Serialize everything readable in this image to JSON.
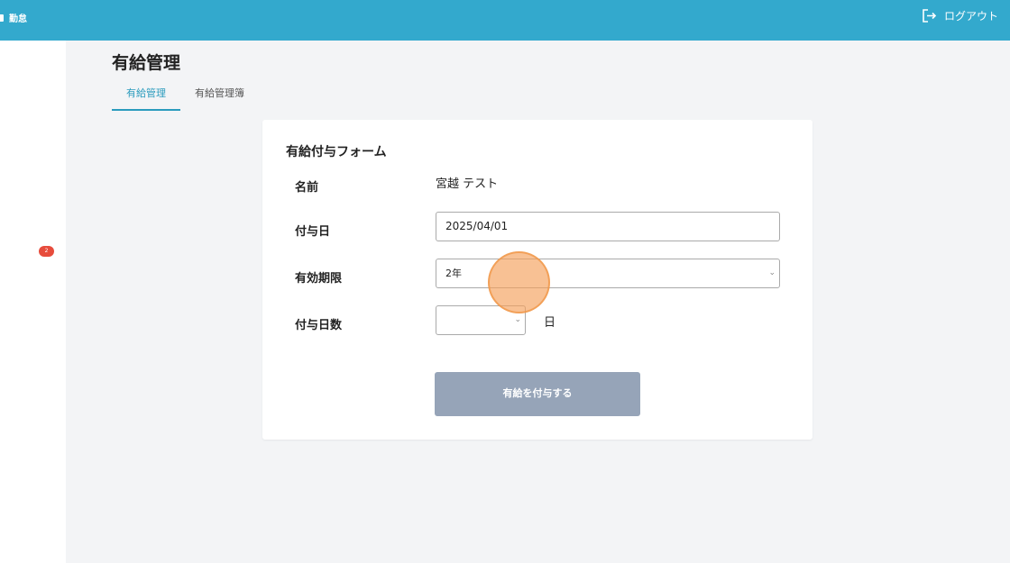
{
  "header": {
    "brand": "勤怠",
    "logout_label": "ログアウト"
  },
  "sidebar": {
    "badge_count": "2"
  },
  "page": {
    "title": "有給管理",
    "tabs": [
      {
        "label": "有給管理",
        "active": true
      },
      {
        "label": "有給管理簿",
        "active": false
      }
    ]
  },
  "form": {
    "title": "有給付与フォーム",
    "name_label": "名前",
    "name_value": "宮越 テスト",
    "grant_date_label": "付与日",
    "grant_date_value": "2025/04/01",
    "validity_label": "有効期限",
    "validity_value": "2年",
    "days_label": "付与日数",
    "days_value": "",
    "days_unit": "日",
    "submit_label": "有給を付与する"
  },
  "colors": {
    "header": "#33a9cd",
    "accent": "#2a9bbd",
    "submit_disabled": "#96a4b8",
    "badge": "#e74c3c"
  }
}
